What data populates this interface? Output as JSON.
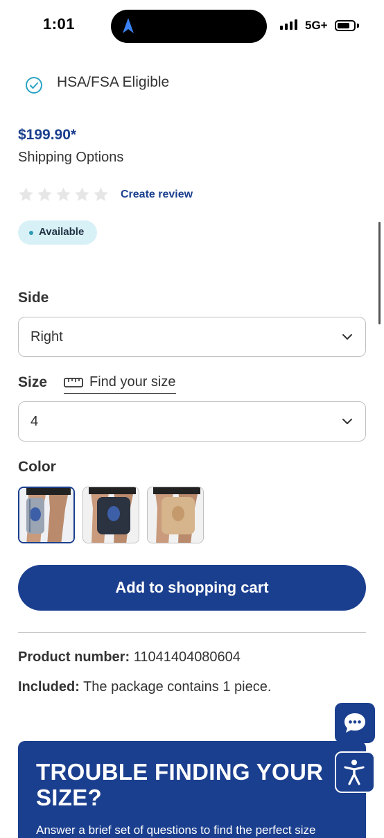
{
  "status_bar": {
    "time": "1:01",
    "network": "5G+"
  },
  "product": {
    "hsa_label": "HSA/FSA Eligible",
    "price": "$199.90*",
    "shipping_options": "Shipping Options",
    "rating_stars": 0,
    "create_review": "Create review",
    "availability": "Available"
  },
  "side": {
    "label": "Side",
    "value": "Right"
  },
  "size": {
    "label": "Size",
    "find_size": "Find your size",
    "value": "4"
  },
  "color": {
    "label": "Color",
    "swatches": [
      {
        "name": "gray-blue",
        "selected": true
      },
      {
        "name": "black",
        "selected": false
      },
      {
        "name": "beige",
        "selected": false
      }
    ]
  },
  "cart": {
    "button_label": "Add to shopping cart"
  },
  "details": {
    "product_number_label": "Product number:",
    "product_number_value": "11041404080604",
    "included_label": "Included:",
    "included_value": "The package contains 1 piece."
  },
  "banner": {
    "title": "TROUBLE FINDING YOUR SIZE?",
    "subtitle": "Answer a brief set of questions to find the perfect size"
  },
  "colors": {
    "brand_blue": "#1b3f8f",
    "badge_bg": "#d8f1f7",
    "check_teal": "#2ba3c3"
  },
  "icons": [
    "location-arrow-icon",
    "signal-icon",
    "battery-icon",
    "check-circle-icon",
    "star-icon",
    "chevron-down-icon",
    "ruler-icon",
    "chat-icon",
    "accessibility-icon"
  ]
}
